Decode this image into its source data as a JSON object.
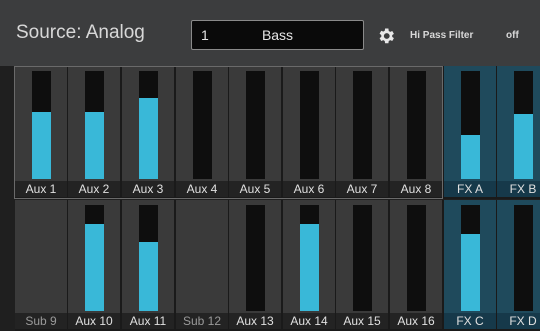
{
  "header": {
    "source_title": "Source: Analog",
    "channel_number": "1",
    "channel_name": "Bass",
    "hpf_label": "Hi Pass Filter",
    "hpf_value": "off",
    "icon": "gear-icon"
  },
  "colors": {
    "meter_fill": "#39b8d8",
    "fx_background": "#1f4a5c"
  },
  "rows": [
    {
      "cells": [
        {
          "label": "Aux 1",
          "level": 0.62,
          "active": true,
          "fx": false
        },
        {
          "label": "Aux 2",
          "level": 0.62,
          "active": true,
          "fx": false
        },
        {
          "label": "Aux 3",
          "level": 0.75,
          "active": true,
          "fx": false
        },
        {
          "label": "Aux 4",
          "level": 0.0,
          "active": true,
          "fx": false
        },
        {
          "label": "Aux 5",
          "level": 0.0,
          "active": true,
          "fx": false
        },
        {
          "label": "Aux 6",
          "level": 0.0,
          "active": true,
          "fx": false
        },
        {
          "label": "Aux 7",
          "level": 0.0,
          "active": true,
          "fx": false
        },
        {
          "label": "Aux 8",
          "level": 0.0,
          "active": true,
          "fx": false
        },
        {
          "label": "FX A",
          "level": 0.41,
          "active": true,
          "fx": true
        },
        {
          "label": "FX B",
          "level": 0.6,
          "active": true,
          "fx": true
        }
      ]
    },
    {
      "cells": [
        {
          "label": "Sub 9",
          "level": null,
          "active": false,
          "fx": false
        },
        {
          "label": "Aux 10",
          "level": 0.82,
          "active": true,
          "fx": false
        },
        {
          "label": "Aux 11",
          "level": 0.65,
          "active": true,
          "fx": false
        },
        {
          "label": "Sub 12",
          "level": null,
          "active": false,
          "fx": false
        },
        {
          "label": "Aux 13",
          "level": 0.0,
          "active": true,
          "fx": false
        },
        {
          "label": "Aux 14",
          "level": 0.82,
          "active": true,
          "fx": false
        },
        {
          "label": "Aux 15",
          "level": 0.0,
          "active": true,
          "fx": false
        },
        {
          "label": "Aux 16",
          "level": 0.0,
          "active": true,
          "fx": false
        },
        {
          "label": "FX C",
          "level": 0.73,
          "active": true,
          "fx": true
        },
        {
          "label": "FX D",
          "level": 0.0,
          "active": true,
          "fx": true
        }
      ]
    }
  ]
}
